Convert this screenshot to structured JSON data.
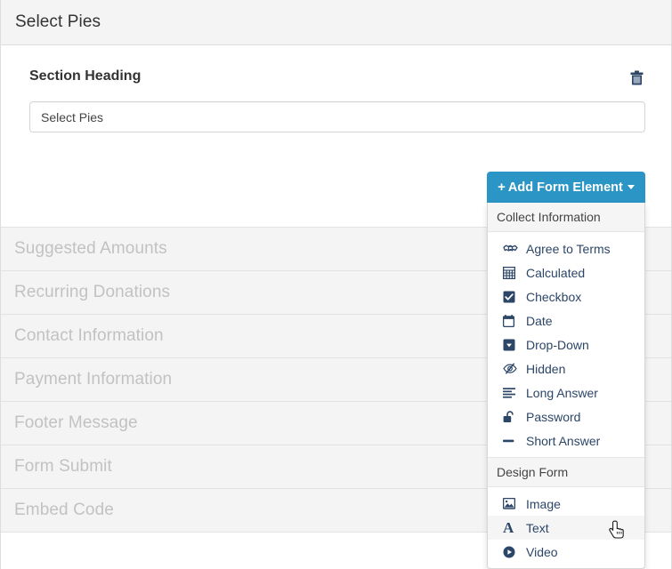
{
  "header": {
    "title": "Select Pies"
  },
  "section": {
    "label": "Section Heading",
    "delete_icon": "trash-icon",
    "heading_input": {
      "value": "Select Pies",
      "placeholder": "Section Heading"
    }
  },
  "collapsed_sections": [
    {
      "label": "Suggested Amounts"
    },
    {
      "label": "Recurring Donations"
    },
    {
      "label": "Contact Information"
    },
    {
      "label": "Payment Information"
    },
    {
      "label": "Footer Message"
    },
    {
      "label": "Form Submit"
    },
    {
      "label": "Embed Code"
    }
  ],
  "add_element": {
    "button_label": "Add Form Element",
    "plus": "+",
    "caret_icon": "chevron-down-icon",
    "button_color": "#2b95c5",
    "menu_text_color": "#2c4668",
    "groups": [
      {
        "title": "Collect Information",
        "items": [
          {
            "label": "Agree to Terms",
            "icon": "handshake-icon"
          },
          {
            "label": "Calculated",
            "icon": "calculator-icon"
          },
          {
            "label": "Checkbox",
            "icon": "checkbox-icon"
          },
          {
            "label": "Date",
            "icon": "calendar-icon"
          },
          {
            "label": "Drop-Down",
            "icon": "caret-square-down-icon"
          },
          {
            "label": "Hidden",
            "icon": "eye-slash-icon"
          },
          {
            "label": "Long Answer",
            "icon": "align-left-icon"
          },
          {
            "label": "Password",
            "icon": "unlock-icon"
          },
          {
            "label": "Short Answer",
            "icon": "minus-icon"
          }
        ]
      },
      {
        "title": "Design Form",
        "items": [
          {
            "label": "Image",
            "icon": "image-icon"
          },
          {
            "label": "Text",
            "icon": "letter-a-icon",
            "hovered": true
          },
          {
            "label": "Video",
            "icon": "play-circle-icon"
          }
        ]
      }
    ]
  },
  "cursor": {
    "icon": "pointer-hand-cursor"
  }
}
